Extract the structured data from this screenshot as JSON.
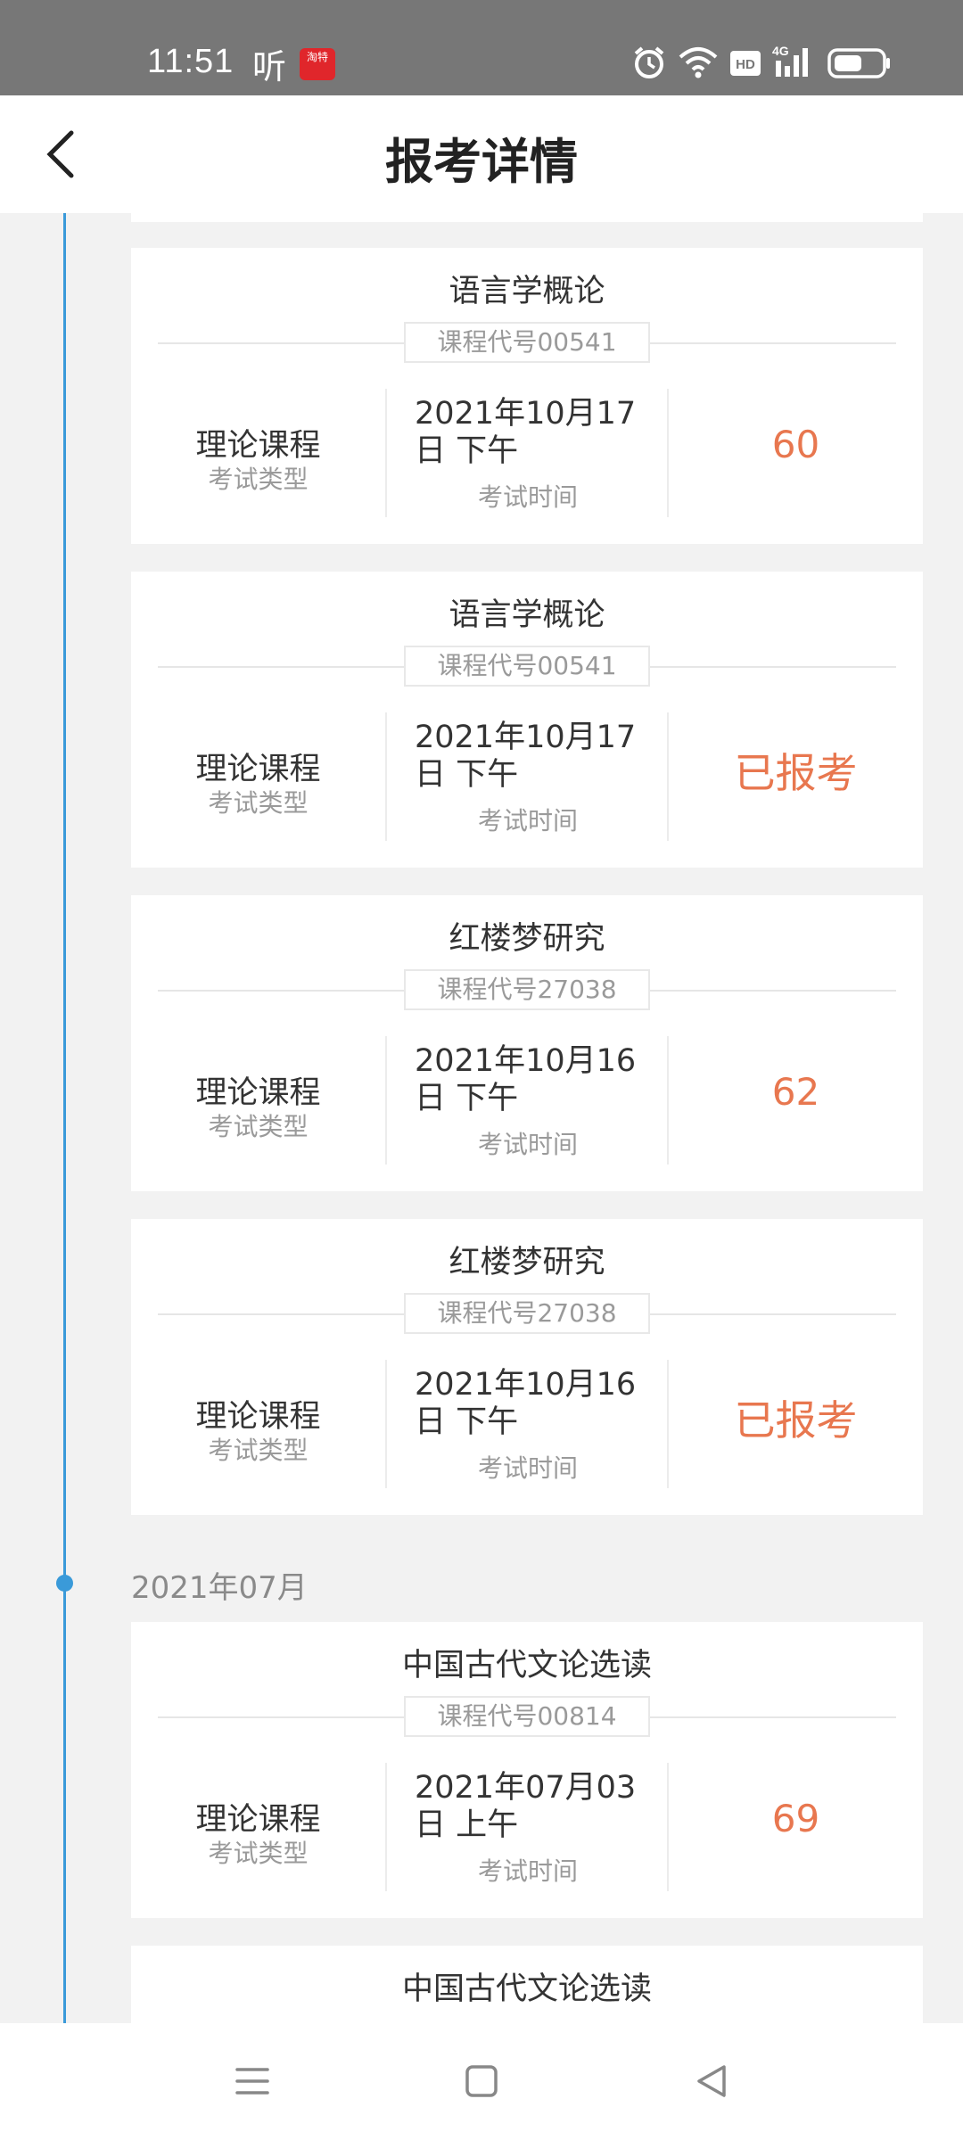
{
  "status_bar": {
    "time": "11:51",
    "ting_glyph": "听",
    "app_icon_text": "淘特"
  },
  "header": {
    "title": "报考详情"
  },
  "month_group": {
    "label": "2021年07月"
  },
  "cards": [
    {
      "course_name": "语言学概论",
      "course_code": "课程代号00541",
      "exam_type": "理论课程",
      "exam_type_label": "考试类型",
      "exam_time_line1": "2021年10月17",
      "exam_time_line2": "日 下午",
      "exam_time_label": "考试时间",
      "result": "60"
    },
    {
      "course_name": "语言学概论",
      "course_code": "课程代号00541",
      "exam_type": "理论课程",
      "exam_type_label": "考试类型",
      "exam_time_line1": "2021年10月17",
      "exam_time_line2": "日 下午",
      "exam_time_label": "考试时间",
      "result": "已报考"
    },
    {
      "course_name": "红楼梦研究",
      "course_code": "课程代号27038",
      "exam_type": "理论课程",
      "exam_type_label": "考试类型",
      "exam_time_line1": "2021年10月16",
      "exam_time_line2": "日 下午",
      "exam_time_label": "考试时间",
      "result": "62"
    },
    {
      "course_name": "红楼梦研究",
      "course_code": "课程代号27038",
      "exam_type": "理论课程",
      "exam_type_label": "考试类型",
      "exam_time_line1": "2021年10月16",
      "exam_time_line2": "日 下午",
      "exam_time_label": "考试时间",
      "result": "已报考"
    },
    {
      "course_name": "中国古代文论选读",
      "course_code": "课程代号00814",
      "exam_type": "理论课程",
      "exam_type_label": "考试类型",
      "exam_time_line1": "2021年07月03",
      "exam_time_line2": "日 上午",
      "exam_time_label": "考试时间",
      "result": "69"
    },
    {
      "course_name": "中国古代文论选读"
    }
  ],
  "colors": {
    "accent_orange": "#e8774f",
    "timeline_blue": "#3a9ad9"
  },
  "icons": {
    "back": "chevron-left-icon",
    "alarm": "alarm-icon",
    "wifi": "wifi-icon",
    "hd": "hd-icon",
    "signal": "signal-4g-icon",
    "battery": "battery-icon",
    "nav_menu": "menu-icon",
    "nav_home": "home-icon",
    "nav_back": "back-triangle-icon"
  }
}
